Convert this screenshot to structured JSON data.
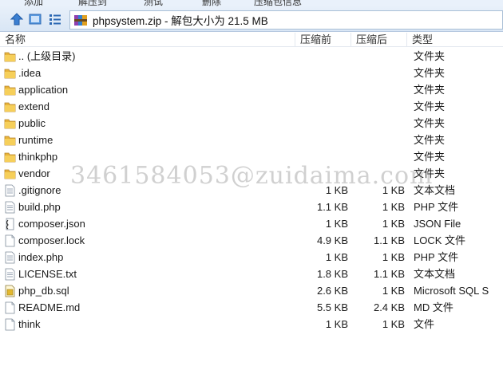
{
  "toolbar": {
    "labels": [
      "添加",
      "解压到",
      "测试",
      "删除",
      "压缩包信息"
    ]
  },
  "address_bar": {
    "path": "phpsystem.zip - 解包大小为 21.5 MB"
  },
  "columns": {
    "name": "名称",
    "packed": "压缩前",
    "size": "压缩后",
    "type": "类型"
  },
  "files": [
    {
      "name": ".. (上级目录)",
      "packed": "",
      "size": "",
      "type": "文件夹",
      "icon": "folder-icon"
    },
    {
      "name": ".idea",
      "packed": "",
      "size": "",
      "type": "文件夹",
      "icon": "folder-icon"
    },
    {
      "name": "application",
      "packed": "",
      "size": "",
      "type": "文件夹",
      "icon": "folder-icon"
    },
    {
      "name": "extend",
      "packed": "",
      "size": "",
      "type": "文件夹",
      "icon": "folder-icon"
    },
    {
      "name": "public",
      "packed": "",
      "size": "",
      "type": "文件夹",
      "icon": "folder-icon"
    },
    {
      "name": "runtime",
      "packed": "",
      "size": "",
      "type": "文件夹",
      "icon": "folder-icon"
    },
    {
      "name": "thinkphp",
      "packed": "",
      "size": "",
      "type": "文件夹",
      "icon": "folder-icon"
    },
    {
      "name": "vendor",
      "packed": "",
      "size": "",
      "type": "文件夹",
      "icon": "folder-icon"
    },
    {
      "name": ".gitignore",
      "packed": "1 KB",
      "size": "1 KB",
      "type": "文本文档",
      "icon": "text-file-icon"
    },
    {
      "name": "build.php",
      "packed": "1.1 KB",
      "size": "1 KB",
      "type": "PHP 文件",
      "icon": "php-file-icon"
    },
    {
      "name": "composer.json",
      "packed": "1 KB",
      "size": "1 KB",
      "type": "JSON File",
      "icon": "json-file-icon"
    },
    {
      "name": "composer.lock",
      "packed": "4.9 KB",
      "size": "1.1 KB",
      "type": "LOCK 文件",
      "icon": "blank-file-icon"
    },
    {
      "name": "index.php",
      "packed": "1 KB",
      "size": "1 KB",
      "type": "PHP 文件",
      "icon": "php-file-icon"
    },
    {
      "name": "LICENSE.txt",
      "packed": "1.8 KB",
      "size": "1.1 KB",
      "type": "文本文档",
      "icon": "text-file-icon"
    },
    {
      "name": "php_db.sql",
      "packed": "2.6 KB",
      "size": "1 KB",
      "type": "Microsoft SQL S",
      "icon": "sql-file-icon"
    },
    {
      "name": "README.md",
      "packed": "5.5 KB",
      "size": "2.4 KB",
      "type": "MD 文件",
      "icon": "blank-file-icon"
    },
    {
      "name": "think",
      "packed": "1 KB",
      "size": "1 KB",
      "type": "文件",
      "icon": "blank-file-icon"
    }
  ],
  "watermark": "3461584053@zuidaima.com"
}
